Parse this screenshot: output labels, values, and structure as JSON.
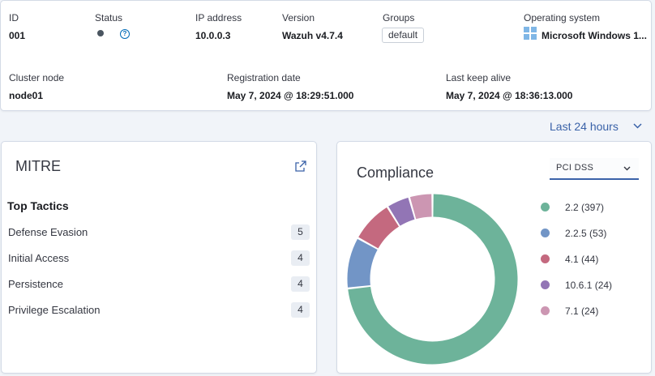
{
  "agent": {
    "id_label": "ID",
    "id": "001",
    "status_label": "Status",
    "ip_label": "IP address",
    "ip": "10.0.0.3",
    "version_label": "Version",
    "version": "Wazuh v4.7.4",
    "groups_label": "Groups",
    "group": "default",
    "os_label": "Operating system",
    "os": "Microsoft Windows 1...",
    "cluster_label": "Cluster node",
    "cluster": "node01",
    "registration_label": "Registration date",
    "registration": "May 7, 2024 @ 18:29:51.000",
    "keepalive_label": "Last keep alive",
    "keepalive": "May 7, 2024 @ 18:36:13.000"
  },
  "timepicker": {
    "label": "Last 24 hours"
  },
  "mitre": {
    "title": "MITRE",
    "subtitle": "Top Tactics",
    "tactics": [
      {
        "name": "Defense Evasion",
        "count": "5"
      },
      {
        "name": "Initial Access",
        "count": "4"
      },
      {
        "name": "Persistence",
        "count": "4"
      },
      {
        "name": "Privilege Escalation",
        "count": "4"
      }
    ]
  },
  "compliance": {
    "title": "Compliance",
    "selected": "PCI DSS"
  },
  "chart_data": {
    "type": "pie",
    "donut": true,
    "categories": [
      "2.2",
      "2.2.5",
      "4.1",
      "10.6.1",
      "7.1"
    ],
    "values": [
      397,
      53,
      44,
      24,
      24
    ],
    "legend": [
      "2.2 (397)",
      "2.2.5 (53)",
      "4.1 (44)",
      "10.6.1 (24)",
      "7.1 (24)"
    ],
    "colors": [
      "#6db39a",
      "#7295c6",
      "#c4697f",
      "#9275b5",
      "#cc96b2"
    ],
    "legend_position": "right"
  }
}
